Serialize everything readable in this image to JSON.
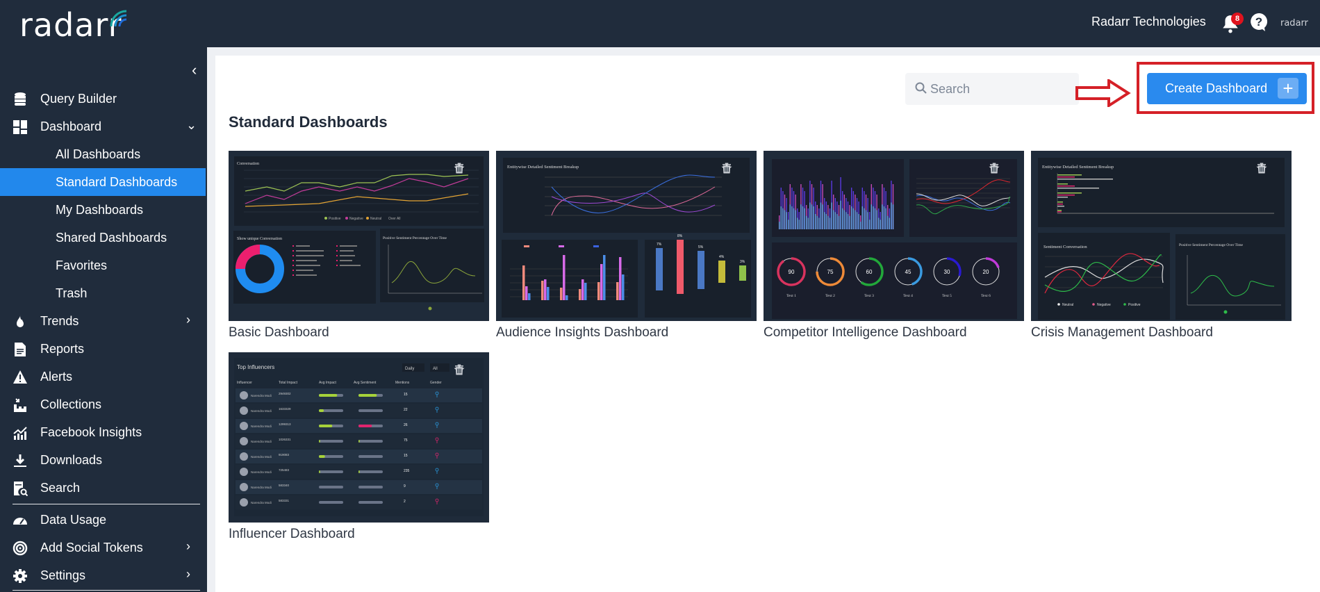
{
  "app": {
    "brand": "radarr",
    "org_name": "Radarr Technologies",
    "notification_count": "8",
    "mini_brand": "radarr"
  },
  "sidebar": {
    "items": [
      {
        "label": "Query Builder",
        "icon": "database-icon"
      },
      {
        "label": "Dashboard",
        "icon": "dashboard-icon",
        "expanded": true
      },
      {
        "label": "All Dashboards",
        "sub": true
      },
      {
        "label": "Standard Dashboards",
        "sub": true,
        "active": true
      },
      {
        "label": "My Dashboards",
        "sub": true
      },
      {
        "label": "Shared Dashboards",
        "sub": true
      },
      {
        "label": "Favorites",
        "sub": true
      },
      {
        "label": "Trash",
        "sub": true
      },
      {
        "label": "Trends",
        "icon": "fire-icon"
      },
      {
        "label": "Reports",
        "icon": "document-icon"
      },
      {
        "label": "Alerts",
        "icon": "warning-icon"
      },
      {
        "label": "Collections",
        "icon": "collections-icon"
      },
      {
        "label": "Facebook Insights",
        "icon": "chart-up-icon"
      },
      {
        "label": "Downloads",
        "icon": "download-icon"
      },
      {
        "label": "Search",
        "icon": "search-doc-icon"
      },
      {
        "label": "Data Usage",
        "icon": "gauge-icon"
      },
      {
        "label": "Add Social Tokens",
        "icon": "target-icon"
      },
      {
        "label": "Settings",
        "icon": "gear-icon"
      }
    ]
  },
  "toolbar": {
    "search_placeholder": "Search",
    "search_value": "",
    "create_label": "Create Dashboard",
    "create_plus": "+"
  },
  "page": {
    "title": "Standard Dashboards"
  },
  "dashboards": [
    {
      "name": "Basic Dashboard",
      "preview": {
        "title_top": "Conversation",
        "legend": [
          "Positive",
          "Negative",
          "Neutral",
          "Over All"
        ],
        "panel_left": "Show unique Conversation",
        "panel_right": "Positive Sentiment Percentage Over Time"
      }
    },
    {
      "name": "Audience Insights Dashboard",
      "preview": {
        "title_top": "Entitywise Detailed Sentiment Breakup",
        "bar_percents": [
          "7%",
          "8%",
          "5%",
          "4%",
          "3%"
        ]
      }
    },
    {
      "name": "Competitor Intelligence Dashboard",
      "preview": {
        "gauges": [
          {
            "value": "90",
            "label": "Text 1"
          },
          {
            "value": "75",
            "label": "Text 2"
          },
          {
            "value": "60",
            "label": "Text 3"
          },
          {
            "value": "45",
            "label": "Text 4"
          },
          {
            "value": "30",
            "label": "Text 5"
          },
          {
            "value": "20",
            "label": "Text 6"
          }
        ]
      }
    },
    {
      "name": "Crisis Management Dashboard",
      "preview": {
        "title_top": "Entitywise Detailed Sentiment Breakup",
        "panel_left": "Sentiment Conversation",
        "panel_right": "Positive Sentiment Percentage Over Time",
        "legend": [
          "Neutral",
          "Negative",
          "Positive"
        ]
      }
    },
    {
      "name": "Influencer Dashboard",
      "preview": {
        "title": "Top Influencers",
        "filter_period": "Daily",
        "filter_scope": "All",
        "columns": [
          "Influencer",
          "Total Impact",
          "Avg Impact",
          "Avg Sentiment",
          "Mentions",
          "Gender"
        ],
        "rows": [
          {
            "name": "Narendra Modi",
            "impact": "2949302",
            "mentions": "15"
          },
          {
            "name": "Narendra Modi",
            "impact": "1633329",
            "mentions": "22"
          },
          {
            "name": "Narendra Modi",
            "impact": "1299313",
            "mentions": "26"
          },
          {
            "name": "Narendra Modi",
            "impact": "1026331",
            "mentions": "75"
          },
          {
            "name": "Narendra Modi",
            "impact": "919083",
            "mentions": "15"
          },
          {
            "name": "Narendra Modi",
            "impact": "725483",
            "mentions": "235"
          },
          {
            "name": "Narendra Modi",
            "impact": "583340",
            "mentions": "9"
          },
          {
            "name": "Narendra Modi",
            "impact": "583331",
            "mentions": "2"
          }
        ]
      }
    }
  ],
  "colors": {
    "sidebar_bg": "#202c3c",
    "accent": "#2288ec",
    "highlight": "#d52027"
  }
}
